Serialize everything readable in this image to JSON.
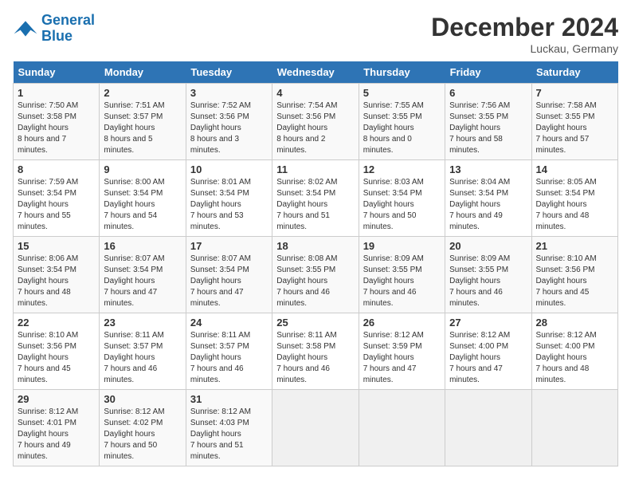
{
  "logo": {
    "line1": "General",
    "line2": "Blue"
  },
  "title": "December 2024",
  "location": "Luckau, Germany",
  "weekdays": [
    "Sunday",
    "Monday",
    "Tuesday",
    "Wednesday",
    "Thursday",
    "Friday",
    "Saturday"
  ],
  "weeks": [
    [
      {
        "day": "1",
        "sunrise": "7:50 AM",
        "sunset": "3:58 PM",
        "daylight": "8 hours and 7 minutes."
      },
      {
        "day": "2",
        "sunrise": "7:51 AM",
        "sunset": "3:57 PM",
        "daylight": "8 hours and 5 minutes."
      },
      {
        "day": "3",
        "sunrise": "7:52 AM",
        "sunset": "3:56 PM",
        "daylight": "8 hours and 3 minutes."
      },
      {
        "day": "4",
        "sunrise": "7:54 AM",
        "sunset": "3:56 PM",
        "daylight": "8 hours and 2 minutes."
      },
      {
        "day": "5",
        "sunrise": "7:55 AM",
        "sunset": "3:55 PM",
        "daylight": "8 hours and 0 minutes."
      },
      {
        "day": "6",
        "sunrise": "7:56 AM",
        "sunset": "3:55 PM",
        "daylight": "7 hours and 58 minutes."
      },
      {
        "day": "7",
        "sunrise": "7:58 AM",
        "sunset": "3:55 PM",
        "daylight": "7 hours and 57 minutes."
      }
    ],
    [
      {
        "day": "8",
        "sunrise": "7:59 AM",
        "sunset": "3:54 PM",
        "daylight": "7 hours and 55 minutes."
      },
      {
        "day": "9",
        "sunrise": "8:00 AM",
        "sunset": "3:54 PM",
        "daylight": "7 hours and 54 minutes."
      },
      {
        "day": "10",
        "sunrise": "8:01 AM",
        "sunset": "3:54 PM",
        "daylight": "7 hours and 53 minutes."
      },
      {
        "day": "11",
        "sunrise": "8:02 AM",
        "sunset": "3:54 PM",
        "daylight": "7 hours and 51 minutes."
      },
      {
        "day": "12",
        "sunrise": "8:03 AM",
        "sunset": "3:54 PM",
        "daylight": "7 hours and 50 minutes."
      },
      {
        "day": "13",
        "sunrise": "8:04 AM",
        "sunset": "3:54 PM",
        "daylight": "7 hours and 49 minutes."
      },
      {
        "day": "14",
        "sunrise": "8:05 AM",
        "sunset": "3:54 PM",
        "daylight": "7 hours and 48 minutes."
      }
    ],
    [
      {
        "day": "15",
        "sunrise": "8:06 AM",
        "sunset": "3:54 PM",
        "daylight": "7 hours and 48 minutes."
      },
      {
        "day": "16",
        "sunrise": "8:07 AM",
        "sunset": "3:54 PM",
        "daylight": "7 hours and 47 minutes."
      },
      {
        "day": "17",
        "sunrise": "8:07 AM",
        "sunset": "3:54 PM",
        "daylight": "7 hours and 47 minutes."
      },
      {
        "day": "18",
        "sunrise": "8:08 AM",
        "sunset": "3:55 PM",
        "daylight": "7 hours and 46 minutes."
      },
      {
        "day": "19",
        "sunrise": "8:09 AM",
        "sunset": "3:55 PM",
        "daylight": "7 hours and 46 minutes."
      },
      {
        "day": "20",
        "sunrise": "8:09 AM",
        "sunset": "3:55 PM",
        "daylight": "7 hours and 46 minutes."
      },
      {
        "day": "21",
        "sunrise": "8:10 AM",
        "sunset": "3:56 PM",
        "daylight": "7 hours and 45 minutes."
      }
    ],
    [
      {
        "day": "22",
        "sunrise": "8:10 AM",
        "sunset": "3:56 PM",
        "daylight": "7 hours and 45 minutes."
      },
      {
        "day": "23",
        "sunrise": "8:11 AM",
        "sunset": "3:57 PM",
        "daylight": "7 hours and 46 minutes."
      },
      {
        "day": "24",
        "sunrise": "8:11 AM",
        "sunset": "3:57 PM",
        "daylight": "7 hours and 46 minutes."
      },
      {
        "day": "25",
        "sunrise": "8:11 AM",
        "sunset": "3:58 PM",
        "daylight": "7 hours and 46 minutes."
      },
      {
        "day": "26",
        "sunrise": "8:12 AM",
        "sunset": "3:59 PM",
        "daylight": "7 hours and 47 minutes."
      },
      {
        "day": "27",
        "sunrise": "8:12 AM",
        "sunset": "4:00 PM",
        "daylight": "7 hours and 47 minutes."
      },
      {
        "day": "28",
        "sunrise": "8:12 AM",
        "sunset": "4:00 PM",
        "daylight": "7 hours and 48 minutes."
      }
    ],
    [
      {
        "day": "29",
        "sunrise": "8:12 AM",
        "sunset": "4:01 PM",
        "daylight": "7 hours and 49 minutes."
      },
      {
        "day": "30",
        "sunrise": "8:12 AM",
        "sunset": "4:02 PM",
        "daylight": "7 hours and 50 minutes."
      },
      {
        "day": "31",
        "sunrise": "8:12 AM",
        "sunset": "4:03 PM",
        "daylight": "7 hours and 51 minutes."
      },
      null,
      null,
      null,
      null
    ]
  ]
}
